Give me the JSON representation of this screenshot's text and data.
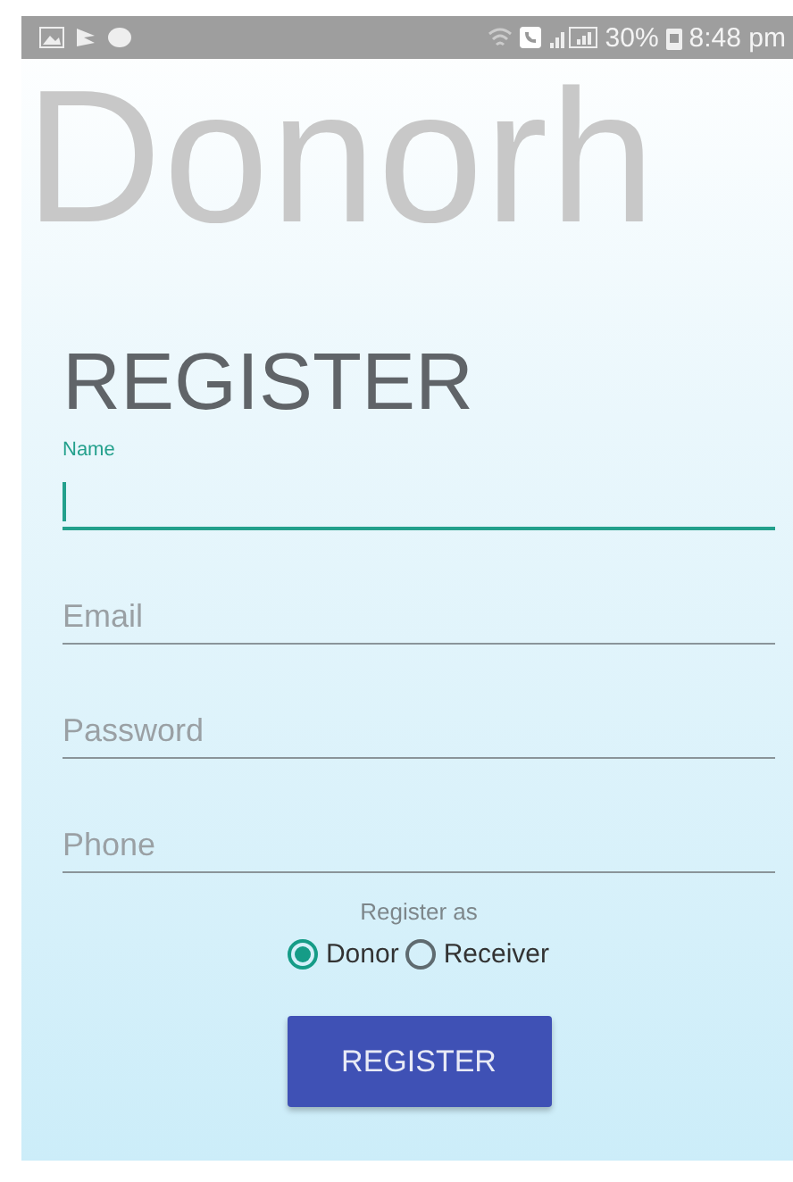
{
  "status_bar": {
    "battery": "30%",
    "time": "8:48 pm"
  },
  "app_title": "Donorh",
  "heading": "REGISTER",
  "fields": [
    {
      "placeholder": "Name",
      "focused": true
    },
    {
      "placeholder": "Email",
      "focused": false
    },
    {
      "placeholder": "Password",
      "focused": false
    },
    {
      "placeholder": "Phone",
      "focused": false
    }
  ],
  "register_as": {
    "label": "Register as",
    "options": [
      {
        "label": "Donor",
        "selected": true
      },
      {
        "label": "Receiver",
        "selected": false
      }
    ]
  },
  "button": "REGISTER"
}
